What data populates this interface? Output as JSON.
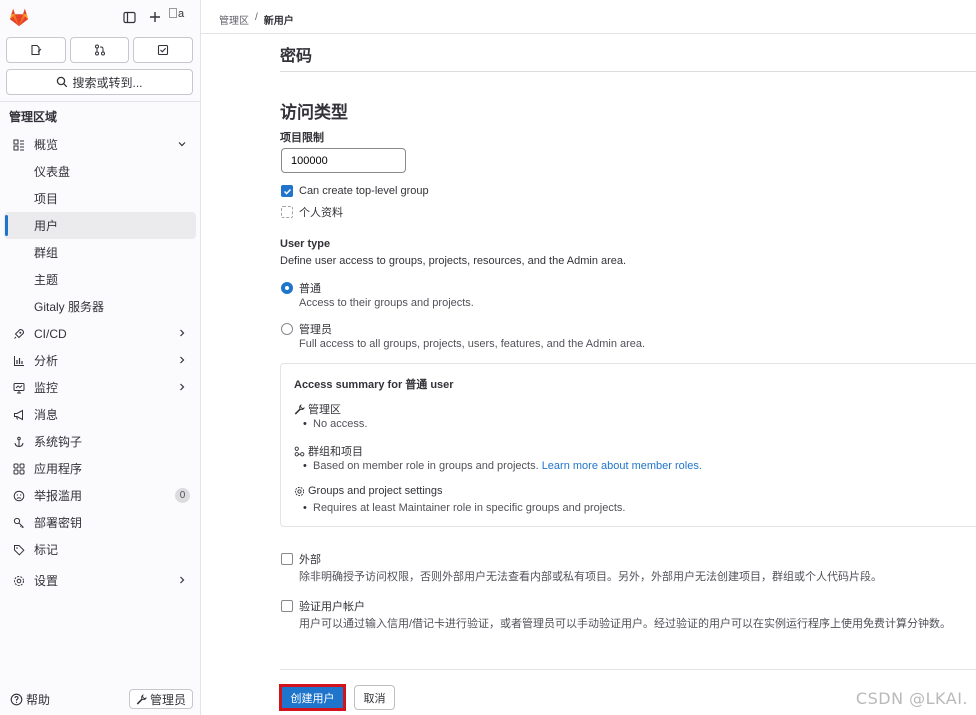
{
  "sidebar": {
    "avatar_alt": "a",
    "search_label": "搜索或转到...",
    "section_heading": "管理区域",
    "items": [
      {
        "label": "概览",
        "icon": "overview-icon",
        "chevron": "down",
        "type": "group"
      },
      {
        "label": "仪表盘",
        "type": "sub"
      },
      {
        "label": "项目",
        "type": "sub"
      },
      {
        "label": "用户",
        "type": "sub",
        "active": true
      },
      {
        "label": "群组",
        "type": "sub"
      },
      {
        "label": "主题",
        "type": "sub"
      },
      {
        "label": "Gitaly 服务器",
        "type": "sub"
      },
      {
        "label": "CI/CD",
        "icon": "rocket-icon",
        "chevron": "right",
        "type": "group"
      },
      {
        "label": "分析",
        "icon": "chart-icon",
        "chevron": "right",
        "type": "group"
      },
      {
        "label": "监控",
        "icon": "monitor-icon",
        "chevron": "right",
        "type": "group"
      },
      {
        "label": "消息",
        "icon": "megaphone-icon",
        "type": "group"
      },
      {
        "label": "系统钩子",
        "icon": "anchor-icon",
        "type": "group"
      },
      {
        "label": "应用程序",
        "icon": "applications-icon",
        "type": "group"
      },
      {
        "label": "举报滥用",
        "icon": "abuse-icon",
        "type": "group",
        "badge": "0"
      },
      {
        "label": "部署密钥",
        "icon": "key-icon",
        "type": "group"
      },
      {
        "label": "标记",
        "icon": "label-icon",
        "type": "group"
      },
      {
        "label": "设置",
        "icon": "settings-icon",
        "chevron": "right",
        "type": "group"
      }
    ],
    "help_label": "帮助",
    "admin_label": "管理员"
  },
  "breadcrumb": {
    "parent": "管理区",
    "separator": "/",
    "current": "新用户"
  },
  "form": {
    "password_heading": "密码",
    "access_heading": "访问类型",
    "projects_limit_label": "项目限制",
    "projects_limit_value": "100000",
    "can_create_group_label": "Can create top-level group",
    "can_create_group_checked": true,
    "private_profile_label": "个人资料",
    "private_profile_checked": false,
    "user_type_label": "User type",
    "user_type_desc": "Define user access to groups, projects, resources, and the Admin area.",
    "regular_label": "普通",
    "regular_desc": "Access to their groups and projects.",
    "regular_selected": true,
    "admin_label": "管理员",
    "admin_desc": "Full access to all groups, projects, users, features, and the Admin area.",
    "admin_selected": false,
    "summary": {
      "title": "Access summary for 普通 user",
      "admin_area_label": "管理区",
      "admin_area_item": "No access.",
      "groups_projects_label": "群组和项目",
      "groups_projects_item": "Based on member role in groups and projects.",
      "groups_projects_link": "Learn more about member roles.",
      "settings_label": "Groups and project settings",
      "settings_item": "Requires at least Maintainer role in specific groups and projects."
    },
    "external_label": "外部",
    "external_desc": "除非明确授予访问权限，否则外部用户无法查看内部或私有项目。另外，外部用户无法创建项目，群组或个人代码片段。",
    "external_checked": false,
    "validate_label": "验证用户帐户",
    "validate_desc": "用户可以通过输入信用/借记卡进行验证，或者管理员可以手动验证用户。经过验证的用户可以在实例运行程序上使用免费计算分钟数。",
    "validate_checked": false,
    "create_button": "创建用户",
    "cancel_button": "取消"
  },
  "watermark": "CSDN @LKAI.",
  "colors": {
    "accent": "#1f75cb",
    "highlight_border": "#d1141c",
    "sidebar_bg": "#fbfafd",
    "logo_orange": "#e24329"
  }
}
